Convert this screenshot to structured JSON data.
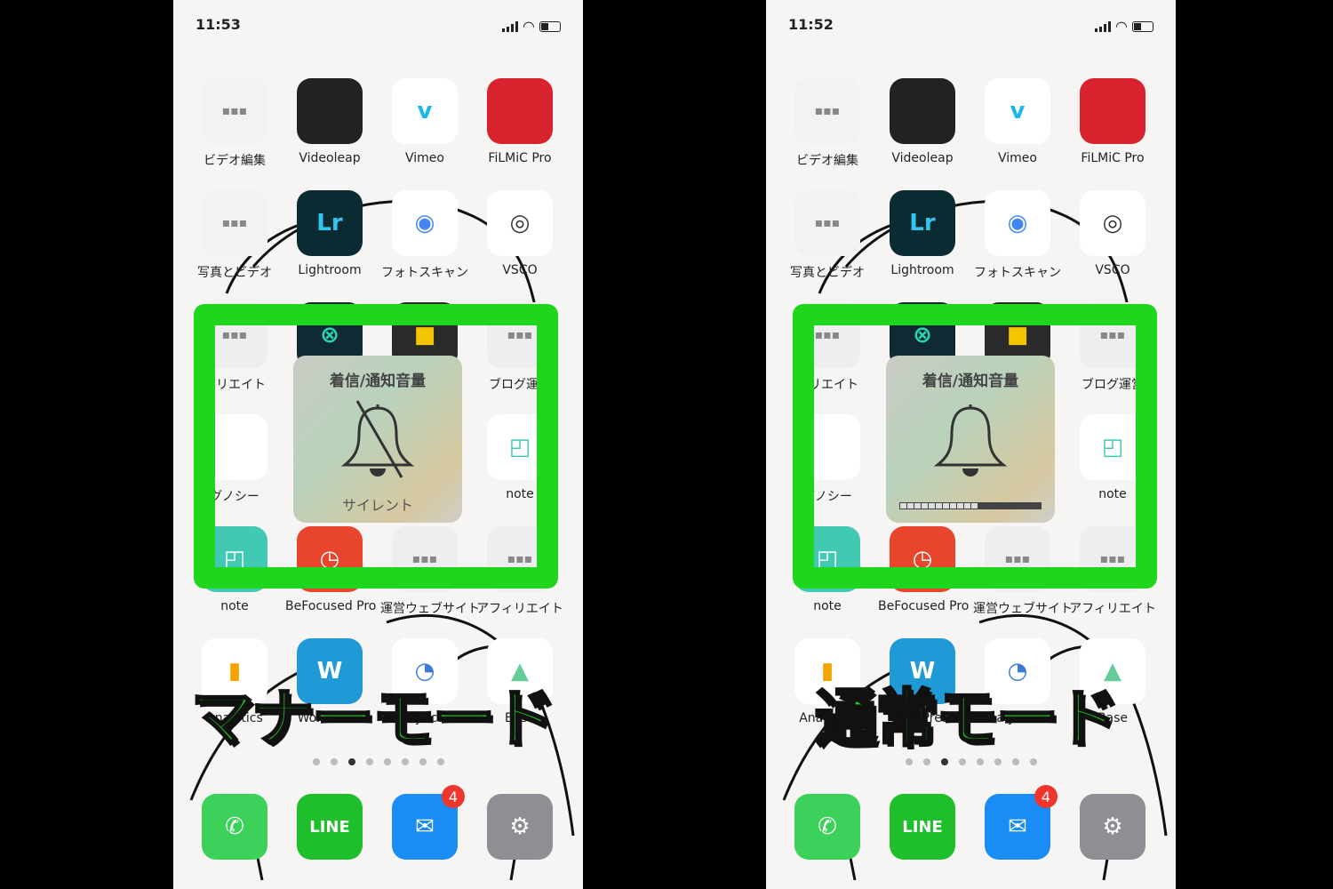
{
  "colors": {
    "highlight": "#1ed61e",
    "caption": "#1fe01f",
    "badge": "#f0362c"
  },
  "phones": [
    {
      "id": "left",
      "time": "11:53",
      "caption": "マナーモード",
      "hud": {
        "title": "着信/通知音量",
        "state": "サイレント",
        "muted": true,
        "volume_level": 0
      }
    },
    {
      "id": "right",
      "time": "11:52",
      "caption": "通常モード",
      "hud": {
        "title": "着信/通知音量",
        "state": "",
        "muted": false,
        "volume_level": 0.55
      }
    }
  ],
  "apps": [
    [
      {
        "label": "ビデオ編集",
        "icon": "folder-icon",
        "bg": "#f2f2f2"
      },
      {
        "label": "Videoleap",
        "icon": "videoleap-icon",
        "bg": "#222"
      },
      {
        "label": "Vimeo",
        "icon": "vimeo-icon",
        "bg": "#fff",
        "glyph": "v",
        "fg": "#1ab7ea"
      },
      {
        "label": "FiLMiC Pro",
        "icon": "filmic-icon",
        "bg": "#d8222d"
      }
    ],
    [
      {
        "label": "写真とビデオ",
        "icon": "folder-icon",
        "bg": "#f2f2f2"
      },
      {
        "label": "Lightroom",
        "icon": "lightroom-icon",
        "bg": "#0b2b33",
        "glyph": "Lr",
        "fg": "#31c5f0"
      },
      {
        "label": "フォトスキャン",
        "icon": "photoscan-icon",
        "bg": "#fff",
        "glyph": "◉",
        "fg": "#4285f4"
      },
      {
        "label": "VSCO",
        "icon": "vsco-icon",
        "bg": "#fff",
        "glyph": "◎",
        "fg": "#333"
      }
    ],
    [
      {
        "label": "クリエイト",
        "icon": "folder-icon",
        "bg": "#eee"
      },
      {
        "label": "",
        "icon": "app-icon",
        "bg": "#0f2a33",
        "glyph": "⊗",
        "fg": "#2bd3b0"
      },
      {
        "label": "",
        "icon": "app-icon",
        "bg": "#2a2a2a",
        "glyph": "■",
        "fg": "#f5c400"
      },
      {
        "label": "ブログ運営",
        "icon": "folder-icon",
        "bg": "#eee"
      }
    ],
    [
      {
        "label": "グノシー",
        "icon": "gunosy-icon",
        "bg": "#fff"
      },
      {
        "label": "",
        "icon": "",
        "bg": "transparent"
      },
      {
        "label": "",
        "icon": "",
        "bg": "transparent"
      },
      {
        "label": "note",
        "icon": "note-icon",
        "bg": "#fff",
        "glyph": "◰",
        "fg": "#41c9b4"
      }
    ],
    [
      {
        "label": "note",
        "icon": "note-icon",
        "bg": "#41c9b4",
        "glyph": "◰"
      },
      {
        "label": "BeFocused Pro",
        "icon": "befocused-icon",
        "bg": "#e8452c",
        "glyph": "◷"
      },
      {
        "label": "運営ウェブサイト",
        "icon": "folder-icon",
        "bg": "#eee"
      },
      {
        "label": "アフィリエイト",
        "icon": "folder-icon",
        "bg": "#eee"
      }
    ],
    [
      {
        "label": "Analytics",
        "icon": "analytics-icon",
        "bg": "#fff",
        "glyph": "▮",
        "fg": "#f4a300"
      },
      {
        "label": "WordPress",
        "icon": "wordpress-icon",
        "bg": "#1f9ad6",
        "glyph": "W"
      },
      {
        "label": "AnalyticsPM",
        "icon": "analyticspm-icon",
        "bg": "#fff",
        "glyph": "◔",
        "fg": "#3a7bd5"
      },
      {
        "label": "Base",
        "icon": "base-icon",
        "bg": "#fff",
        "glyph": "▲",
        "fg": "#6c9"
      }
    ]
  ],
  "dock": [
    {
      "label": "",
      "icon": "phone-icon",
      "bg": "#3bd15a",
      "glyph": "✆"
    },
    {
      "label": "",
      "icon": "line-icon",
      "bg": "#1fbf2b",
      "glyph": "LINE"
    },
    {
      "label": "",
      "icon": "mail-icon",
      "bg": "#1a8cf5",
      "glyph": "✉",
      "badge": "4"
    },
    {
      "label": "",
      "icon": "settings-icon",
      "bg": "#8e8e93",
      "glyph": "⚙"
    }
  ],
  "page_dots": {
    "count": 8,
    "current": 3
  }
}
